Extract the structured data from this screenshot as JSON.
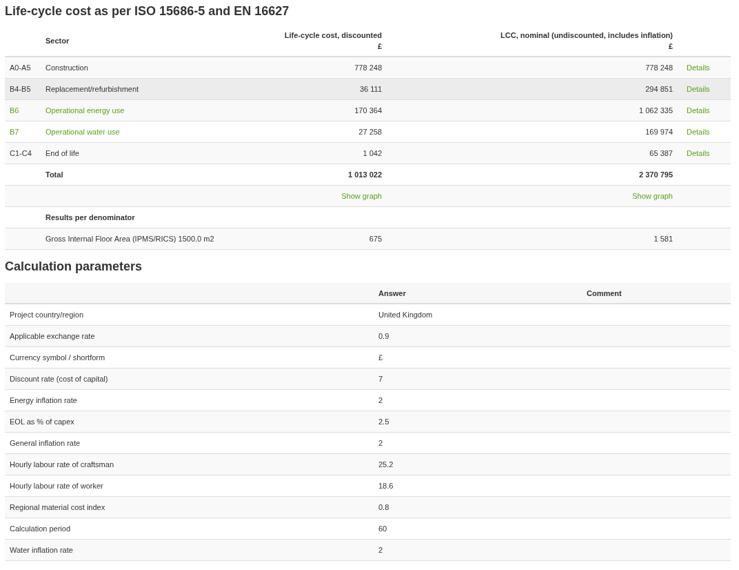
{
  "lcc": {
    "title": "Life-cycle cost as per ISO 15686-5 and EN 16627",
    "columns": {
      "sector": "Sector",
      "discounted": "Life-cycle cost, discounted",
      "discounted_unit": "£",
      "nominal": "LCC, nominal (undiscounted, includes inflation)",
      "nominal_unit": "£"
    },
    "rows": [
      {
        "code": "A0-A5",
        "sector": "Construction",
        "discounted": "778 248",
        "nominal": "778 248",
        "link": "Details",
        "kind": "normal",
        "hovered": false
      },
      {
        "code": "B4-B5",
        "sector": "Replacement/refurbishment",
        "discounted": "36 111",
        "nominal": "294 851",
        "link": "Details",
        "kind": "normal",
        "hovered": true
      },
      {
        "code": "B6",
        "sector": "Operational energy use",
        "discounted": "170 364",
        "nominal": "1 062 335",
        "link": "Details",
        "kind": "operational",
        "hovered": false
      },
      {
        "code": "B7",
        "sector": "Operational water use",
        "discounted": "27 258",
        "nominal": "169 974",
        "link": "Details",
        "kind": "operational",
        "hovered": false
      },
      {
        "code": "C1-C4",
        "sector": "End of life",
        "discounted": "1 042",
        "nominal": "65 387",
        "link": "Details",
        "kind": "normal",
        "hovered": false
      }
    ],
    "total": {
      "label": "Total",
      "discounted": "1 013 022",
      "nominal": "2 370 795"
    },
    "graph_links": {
      "discounted": "Show graph",
      "nominal": "Show graph"
    },
    "denominator": {
      "heading": "Results per denominator",
      "label": "Gross Internal Floor Area (IPMS/RICS) 1500.0 m2",
      "discounted": "675",
      "nominal": "1 581"
    }
  },
  "parameters": {
    "title": "Calculation parameters",
    "columns": {
      "answer": "Answer",
      "comment": "Comment"
    },
    "rows": [
      {
        "name": "Project country/region",
        "answer": "United Kingdom"
      },
      {
        "name": "Applicable exchange rate",
        "answer": "0.9"
      },
      {
        "name": "Currency symbol / shortform",
        "answer": "£"
      },
      {
        "name": "Discount rate (cost of capital)",
        "answer": "7"
      },
      {
        "name": "Energy inflation rate",
        "answer": "2"
      },
      {
        "name": "EOL as % of capex",
        "answer": "2.5"
      },
      {
        "name": "General inflation rate",
        "answer": "2"
      },
      {
        "name": "Hourly labour rate of craftsman",
        "answer": "25.2"
      },
      {
        "name": "Hourly labour rate of worker",
        "answer": "18.6"
      },
      {
        "name": "Regional material cost index",
        "answer": "0.8"
      },
      {
        "name": "Calculation period",
        "answer": "60"
      },
      {
        "name": "Water inflation rate",
        "answer": "2"
      }
    ]
  }
}
